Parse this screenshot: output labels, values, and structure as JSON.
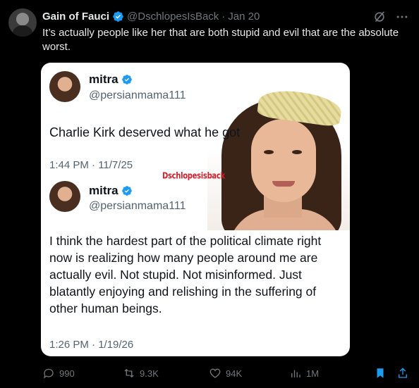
{
  "tweet": {
    "author_name": "Gain of Fauci",
    "handle": "@DschlopesIsBack",
    "separator": "·",
    "date": "Jan 20",
    "text": "It’s actually people like her that are both stupid and evil that are the absolute worst."
  },
  "media": {
    "watermark": "Dschlopesisback",
    "post1": {
      "name": "mitra",
      "handle": "@persianmama111",
      "text": "Charlie Kirk deserved what he got",
      "time": "1:44 PM · 11/7/25"
    },
    "post2": {
      "name": "mitra",
      "handle": "@persianmama111",
      "text_lines": [
        "I think the hardest part of the political climate right",
        "now is realizing how many people around me are",
        "actually evil. Not stupid. Not misinformed. Just",
        "blatantly enjoying and relishing in the suffering of",
        "other human beings."
      ],
      "time": "1:26 PM · 1/19/26"
    }
  },
  "actions": {
    "replies": "990",
    "reposts": "9.3K",
    "likes": "94K",
    "views": "1M"
  },
  "colors": {
    "background": "#000000",
    "verified": "#1d9bf0",
    "muted": "#71767b",
    "watermark": "#d0202a"
  }
}
